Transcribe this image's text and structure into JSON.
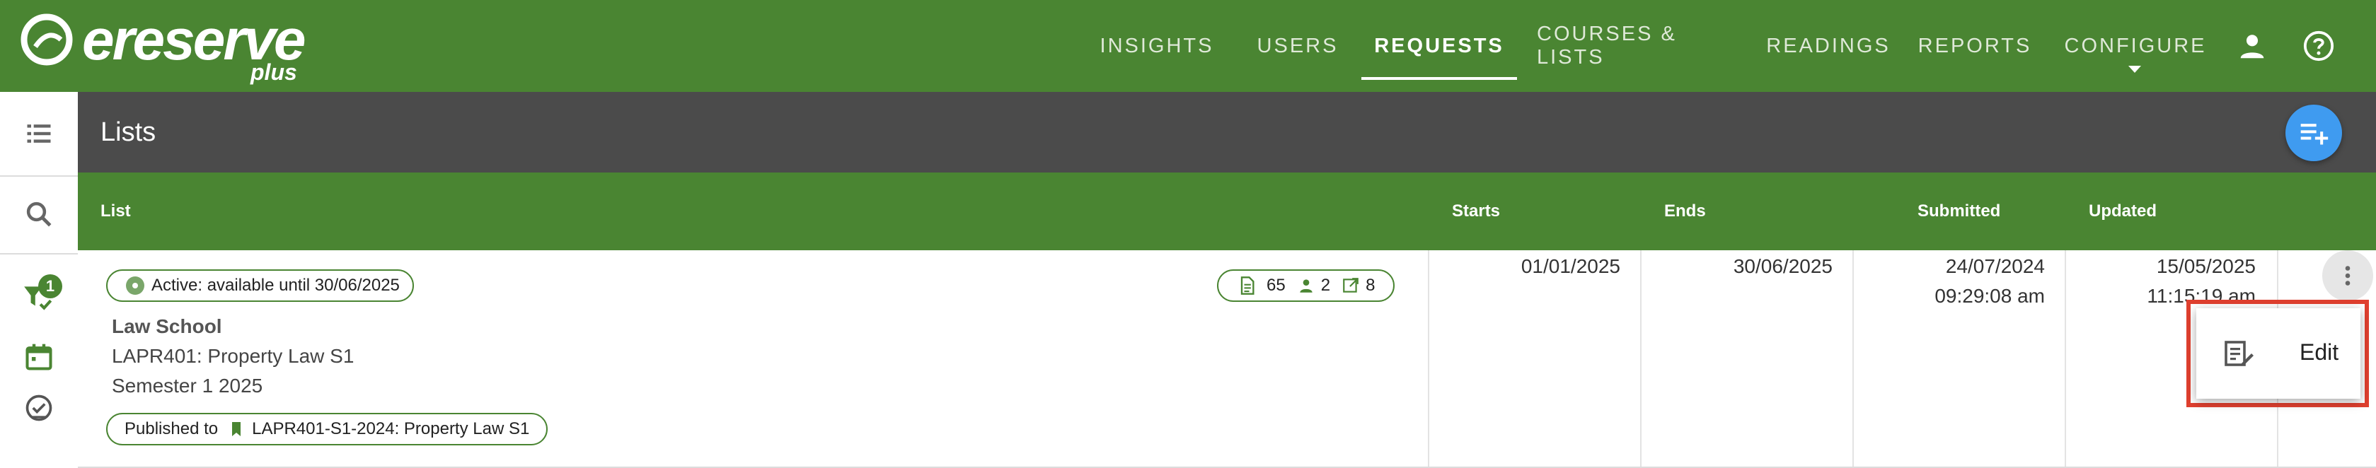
{
  "app": {
    "logo_text": "ereserve",
    "logo_sub": "plus"
  },
  "nav": {
    "items": [
      {
        "label": "INSIGHTS",
        "active": false
      },
      {
        "label": "USERS",
        "active": false
      },
      {
        "label": "REQUESTS",
        "active": true
      },
      {
        "label": "COURSES & LISTS",
        "active": false
      },
      {
        "label": "READINGS",
        "active": false
      },
      {
        "label": "REPORTS",
        "active": false
      },
      {
        "label": "CONFIGURE",
        "active": false
      }
    ],
    "icons": [
      "account-icon",
      "help-icon"
    ]
  },
  "sidebar": {
    "icons": [
      "list-view-icon",
      "search-icon",
      "filter-icon",
      "calendar-icon",
      "check-circle-icon"
    ],
    "filter_badge": "1"
  },
  "page": {
    "title": "Lists"
  },
  "table": {
    "columns": [
      "List",
      "Starts",
      "Ends",
      "Submitted",
      "Updated"
    ],
    "rows": [
      {
        "status": "Active: available until 30/06/2025",
        "counts": {
          "readings": "65",
          "users": "2",
          "links": "8"
        },
        "school": "Law School",
        "course": "LAPR401: Property Law S1",
        "term": "Semester 1 2025",
        "published_label": "Published to",
        "published_target": "LAPR401-S1-2024: Property Law S1",
        "starts": "01/01/2025",
        "ends": "30/06/2025",
        "submitted_date": "24/07/2024",
        "submitted_time": "09:29:08 am",
        "updated_date": "15/05/2025",
        "updated_time": "11:15:19 am"
      }
    ]
  },
  "menu": {
    "edit_label": "Edit"
  },
  "colors": {
    "brand_green": "#4a8532",
    "header_dark": "#4b4b4b",
    "fab_blue": "#3f9bf0",
    "highlight_red": "#e0402f"
  }
}
